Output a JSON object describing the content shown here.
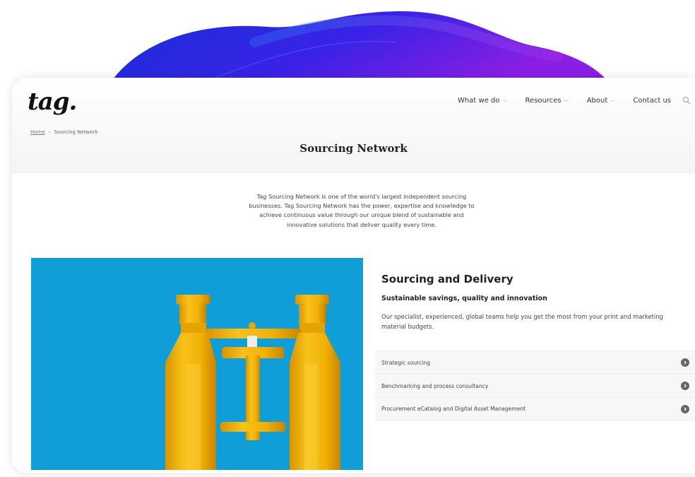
{
  "brand": {
    "logo_text": "tag."
  },
  "nav": {
    "items": [
      {
        "label": "What we do"
      },
      {
        "label": "Resources"
      },
      {
        "label": "About"
      }
    ],
    "contact_label": "Contact us"
  },
  "breadcrumb": {
    "home": "Home",
    "current": "Sourcing Network"
  },
  "page": {
    "title": "Sourcing Network",
    "intro": "Tag Sourcing Network is one of the world's largest independent sourcing businesses. Tag Sourcing Network has the power, expertise and knowledge to achieve continuous value through our unique blend of sustainable and innovative solutions that deliver quality every time."
  },
  "section": {
    "title": "Sourcing and Delivery",
    "subtitle": "Sustainable savings, quality and innovation",
    "description": "Our specialist, experienced, global teams help you get the most from your print and marketing material budgets.",
    "accordion": [
      {
        "label": "Strategic sourcing"
      },
      {
        "label": "Benchmarking and process consultancy"
      },
      {
        "label": "Procurement eCatalog and Digital Asset Management"
      }
    ]
  },
  "colors": {
    "wave_start": "#1a2fd6",
    "wave_end": "#7b1fe0",
    "photo_bg": "#0f9ed8",
    "binocular_yellow": "#f4b400"
  },
  "icons": {
    "nav_chevron": "chevron-down-icon",
    "search": "search-icon",
    "accordion": "chevron-right-circle-icon"
  }
}
